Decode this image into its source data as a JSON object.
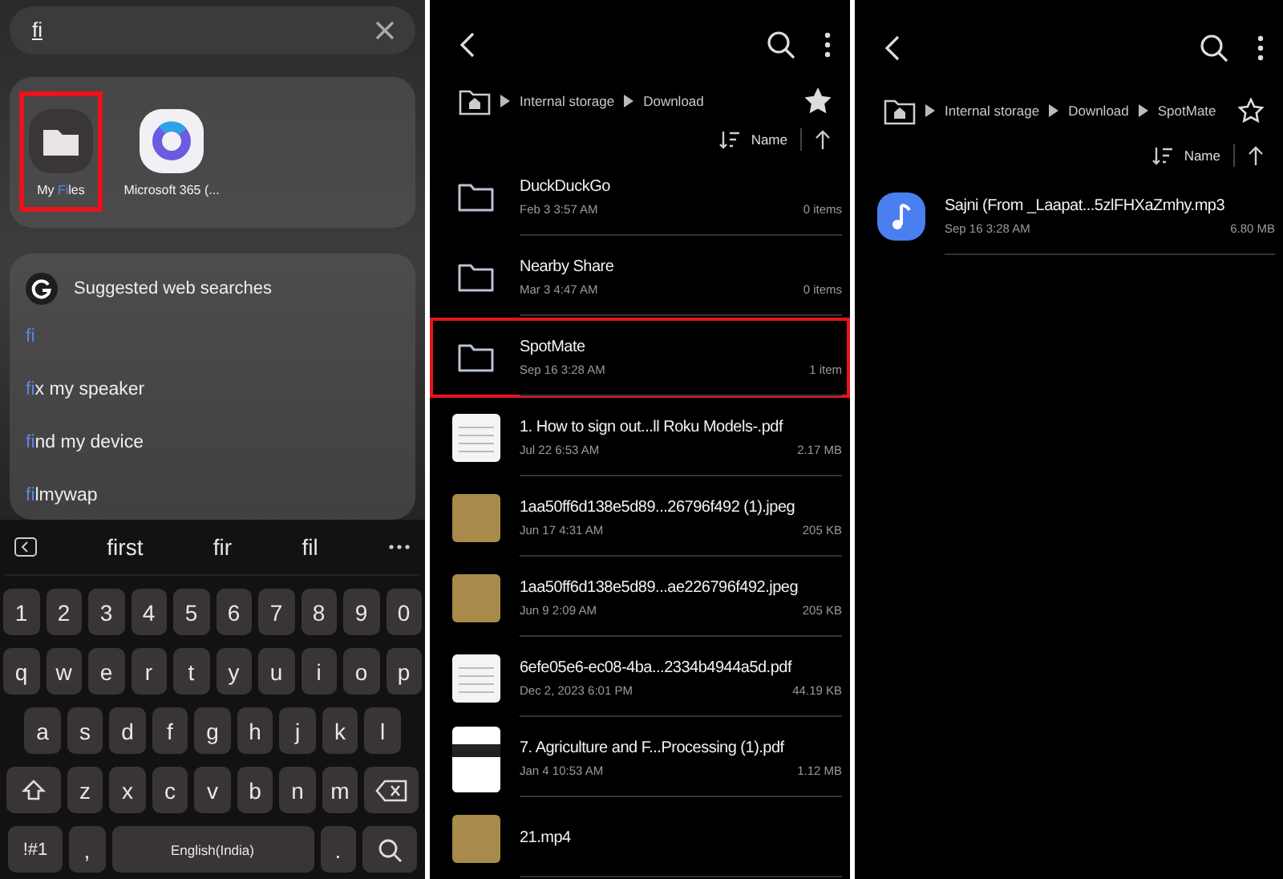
{
  "launcher": {
    "search": {
      "value": "fi"
    },
    "apps": [
      {
        "kind": "files",
        "highlighted": true,
        "label": {
          "before": "My ",
          "match": "Fi",
          "after": "les"
        }
      },
      {
        "kind": "m365",
        "highlighted": false,
        "label": {
          "before": "Microsoft 365 (..."
        }
      }
    ],
    "web_suggestions": {
      "title": "Suggested web searches",
      "items": [
        {
          "match": "fi"
        },
        {
          "match": "fi",
          "after": "x my speaker"
        },
        {
          "match": "fi",
          "after": "nd my device"
        },
        {
          "match": "fi",
          "after": "lmywap"
        }
      ]
    }
  },
  "keyboard": {
    "suggestions": [
      "first",
      "fir",
      "fil"
    ],
    "rows": [
      [
        {
          "kind": "char",
          "label": "1"
        },
        {
          "kind": "char",
          "label": "2"
        },
        {
          "kind": "char",
          "label": "3"
        },
        {
          "kind": "char",
          "label": "4"
        },
        {
          "kind": "char",
          "label": "5"
        },
        {
          "kind": "char",
          "label": "6"
        },
        {
          "kind": "char",
          "label": "7"
        },
        {
          "kind": "char",
          "label": "8"
        },
        {
          "kind": "char",
          "label": "9"
        },
        {
          "kind": "char",
          "label": "0"
        }
      ],
      [
        {
          "kind": "char",
          "label": "q"
        },
        {
          "kind": "char",
          "label": "w"
        },
        {
          "kind": "char",
          "label": "e"
        },
        {
          "kind": "char",
          "label": "r"
        },
        {
          "kind": "char",
          "label": "t"
        },
        {
          "kind": "char",
          "label": "y"
        },
        {
          "kind": "char",
          "label": "u"
        },
        {
          "kind": "char",
          "label": "i"
        },
        {
          "kind": "char",
          "label": "o"
        },
        {
          "kind": "char",
          "label": "p"
        }
      ],
      [
        {
          "kind": "char",
          "label": "a"
        },
        {
          "kind": "char",
          "label": "s"
        },
        {
          "kind": "char",
          "label": "d"
        },
        {
          "kind": "char",
          "label": "f"
        },
        {
          "kind": "char",
          "label": "g"
        },
        {
          "kind": "char",
          "label": "h"
        },
        {
          "kind": "char",
          "label": "j"
        },
        {
          "kind": "char",
          "label": "k"
        },
        {
          "kind": "char",
          "label": "l"
        }
      ],
      [
        {
          "kind": "shift"
        },
        {
          "kind": "char",
          "label": "z"
        },
        {
          "kind": "char",
          "label": "x"
        },
        {
          "kind": "char",
          "label": "c"
        },
        {
          "kind": "char",
          "label": "v"
        },
        {
          "kind": "char",
          "label": "b"
        },
        {
          "kind": "char",
          "label": "n"
        },
        {
          "kind": "char",
          "label": "m"
        },
        {
          "kind": "backspace"
        }
      ]
    ],
    "bottom_row": {
      "symbols": "!#1",
      "comma": ",",
      "space": "English(India)",
      "period": "."
    }
  },
  "panes": [
    {
      "breadcrumb": [
        "Internal storage",
        "Download"
      ],
      "favorite": true,
      "sort": "Name",
      "items": [
        {
          "kind": "folder",
          "name": "DuckDuckGo",
          "date": "Feb 3 3:57 AM",
          "info": "0 items",
          "highlighted": false
        },
        {
          "kind": "folder",
          "name": "Nearby Share",
          "date": "Mar 3 4:47 AM",
          "info": "0 items",
          "highlighted": false
        },
        {
          "kind": "folder",
          "name": "SpotMate",
          "date": "Sep 16 3:28 AM",
          "info": "1 item",
          "highlighted": true
        },
        {
          "kind": "document",
          "name": "1. How to sign out...ll Roku Models-.pdf",
          "date": "Jul 22 6:53 AM",
          "info": "2.17 MB",
          "highlighted": false
        },
        {
          "kind": "photo",
          "name": "1aa50ff6d138e5d89...26796f492 (1).jpeg",
          "date": "Jun 17 4:31 AM",
          "info": "205 KB",
          "highlighted": false
        },
        {
          "kind": "photo",
          "name": "1aa50ff6d138e5d89...ae226796f492.jpeg",
          "date": "Jun 9 2:09 AM",
          "info": "205 KB",
          "highlighted": false
        },
        {
          "kind": "document",
          "name": "6efe05e6-ec08-4ba...2334b4944a5d.pdf",
          "date": "Dec 2, 2023 6:01 PM",
          "info": "44.19 KB",
          "highlighted": false
        },
        {
          "kind": "cover",
          "name": "7. Agriculture and F...Processing  (1).pdf",
          "date": "Jan 4 10:53 AM",
          "info": "1.12 MB",
          "highlighted": false
        },
        {
          "kind": "photo",
          "name": "21.mp4",
          "highlighted": false
        }
      ]
    },
    {
      "breadcrumb": [
        "Internal storage",
        "Download",
        "SpotMate"
      ],
      "favorite": false,
      "sort": "Name",
      "items": [
        {
          "kind": "audio",
          "name": "Sajni (From _Laapat...5zlFHXaZmhy.mp3",
          "date": "Sep 16 3:28 AM",
          "info": "6.80 MB",
          "highlighted": false
        }
      ]
    }
  ]
}
